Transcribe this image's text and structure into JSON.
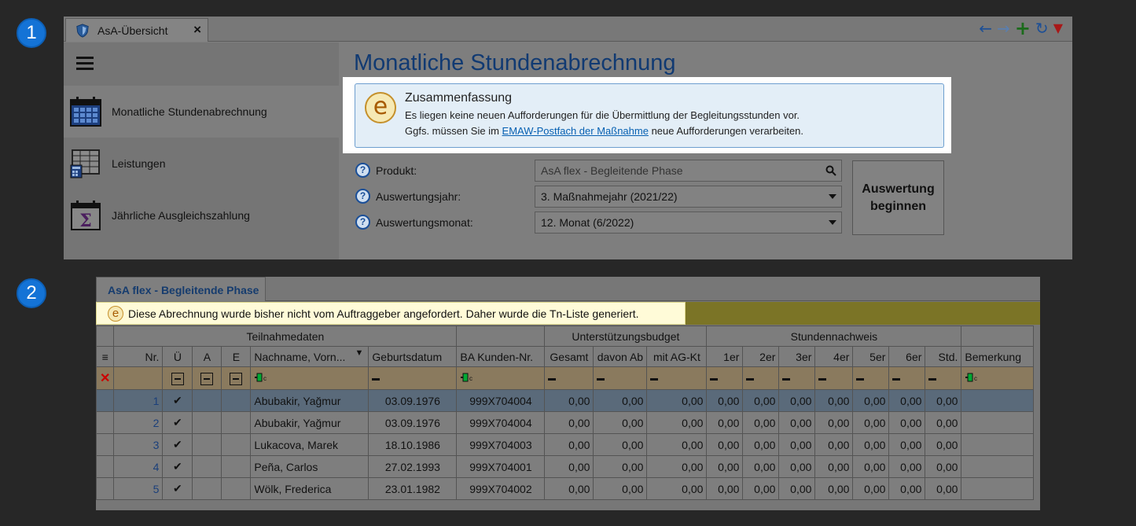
{
  "badges": [
    "1",
    "2"
  ],
  "panel1": {
    "tab_title": "AsA-Übersicht",
    "tab_close": "×",
    "toolbar": {
      "back": "←",
      "forward": "→",
      "add": "+",
      "refresh": "↻",
      "menu": "▼"
    },
    "sidebar": [
      {
        "label": "Monatliche Stundenabrechnung"
      },
      {
        "label": "Leistungen"
      },
      {
        "label": "Jährliche Ausgleichszahlung"
      }
    ],
    "title": "Monatliche Stundenabrechnung",
    "summary": {
      "title": "Zusammenfassung",
      "line1": "Es liegen keine neuen Aufforderungen für die Übermittlung der Begleitungsstunden vor.",
      "line2_pre": "Ggfs. müssen Sie im ",
      "line2_link": "EMAW-Postfach der Maßnahme",
      "line2_post": " neue Aufforderungen verarbeiten.",
      "icon": "e"
    },
    "form": {
      "produkt_label": "Produkt:",
      "produkt_placeholder": "AsA flex - Begleitende Phase",
      "jahr_label": "Auswertungsjahr:",
      "jahr_value": "3. Maßnahmejahr (2021/22)",
      "monat_label": "Auswertungsmonat:",
      "monat_value": "12. Monat (6/2022)",
      "help": "?"
    },
    "button": "Auswertung beginnen"
  },
  "panel2": {
    "tab": "AsA flex - Begleitende Phase",
    "info": "Diese Abrechnung wurde bisher nicht vom Auftraggeber angefordert. Daher wurde die Tn-Liste generiert.",
    "info_icon": "e",
    "groups": {
      "teilnahme": "Teilnahmedaten",
      "budget": "Unterstützungsbudget",
      "nachweis": "Stundennachweis"
    },
    "columns": [
      "Nr.",
      "Ü",
      "A",
      "E",
      "Nachname, Vorn...",
      "Geburtsdatum",
      "BA Kunden-Nr.",
      "Gesamt",
      "davon Ab",
      "mit AG-Kt",
      "1er",
      "2er",
      "3er",
      "4er",
      "5er",
      "6er",
      "Std.",
      "Bemerkung"
    ],
    "filter_icon": "▼",
    "menu_icon": "≡",
    "clear_icon": "✕",
    "check": "✔",
    "rows": [
      {
        "nr": "1",
        "name": "Abubakir, Yağmur",
        "geb": "03.09.1976",
        "ba": "999X704004",
        "vals": [
          "0,00",
          "0,00",
          "0,00",
          "0,00",
          "0,00",
          "0,00",
          "0,00",
          "0,00",
          "0,00",
          "0,00"
        ]
      },
      {
        "nr": "2",
        "name": "Abubakir, Yağmur",
        "geb": "03.09.1976",
        "ba": "999X704004",
        "vals": [
          "0,00",
          "0,00",
          "0,00",
          "0,00",
          "0,00",
          "0,00",
          "0,00",
          "0,00",
          "0,00",
          "0,00"
        ]
      },
      {
        "nr": "3",
        "name": "Lukacova, Marek",
        "geb": "18.10.1986",
        "ba": "999X704003",
        "vals": [
          "0,00",
          "0,00",
          "0,00",
          "0,00",
          "0,00",
          "0,00",
          "0,00",
          "0,00",
          "0,00",
          "0,00"
        ]
      },
      {
        "nr": "4",
        "name": "Peña, Carlos",
        "geb": "27.02.1993",
        "ba": "999X704001",
        "vals": [
          "0,00",
          "0,00",
          "0,00",
          "0,00",
          "0,00",
          "0,00",
          "0,00",
          "0,00",
          "0,00",
          "0,00"
        ]
      },
      {
        "nr": "5",
        "name": "Wölk, Frederica",
        "geb": "23.01.1982",
        "ba": "999X704002",
        "vals": [
          "0,00",
          "0,00",
          "0,00",
          "0,00",
          "0,00",
          "0,00",
          "0,00",
          "0,00",
          "0,00",
          "0,00"
        ]
      }
    ]
  }
}
